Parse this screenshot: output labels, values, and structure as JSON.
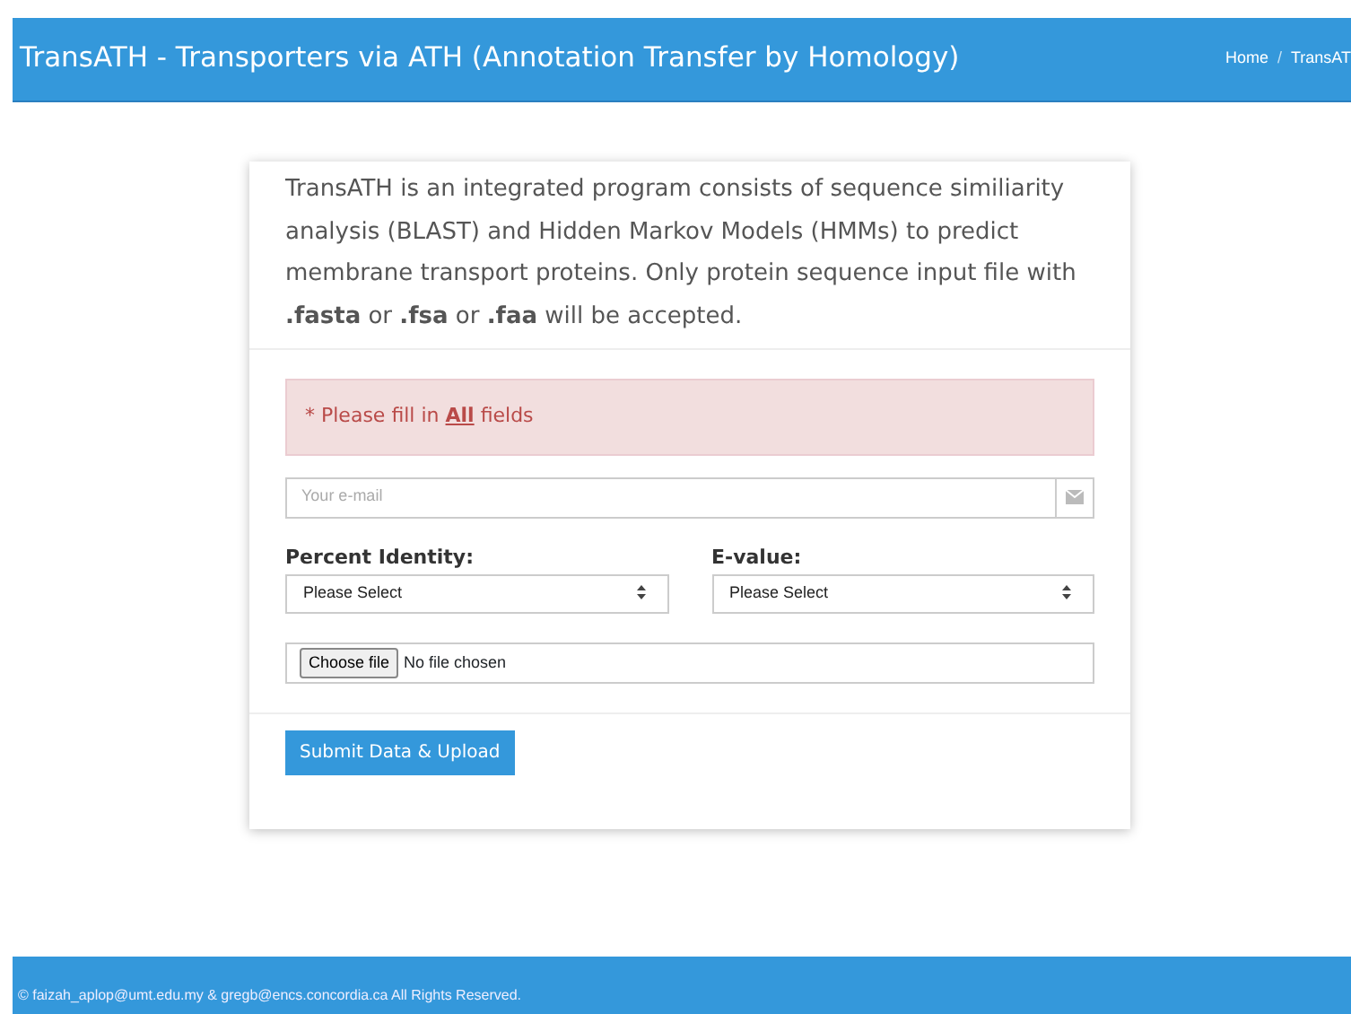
{
  "header": {
    "title": "TransATH - Transporters via ATH (Annotation Transfer by Homology)",
    "breadcrumb": [
      {
        "label": "Home"
      },
      {
        "label": "TransAT"
      }
    ],
    "separator": "/"
  },
  "intro": "TransATH is an integrated program consists of sequence similiarity analysis (BLAST) and Hidden Markov Models (HMMs) to predict membrane transport proteins. Only protein sequence input file with **.fasta** or **.fsa** or **.faa** will be accepted.",
  "alert": {
    "before": "* Please fill in ",
    "emphasis": "All",
    "after": " fields"
  },
  "email": {
    "placeholder": "Your e-mail"
  },
  "selects": [
    {
      "label": "Percent Identity:",
      "value": "Please Select"
    },
    {
      "label": "E-value:",
      "value": "Please Select"
    }
  ],
  "file": {
    "button": "Choose file",
    "status": "No file chosen"
  },
  "submit": "Submit Data & Upload",
  "footer": "© faizah_aplop@umt.edu.my & gregb@encs.concordia.ca All Rights Reserved."
}
